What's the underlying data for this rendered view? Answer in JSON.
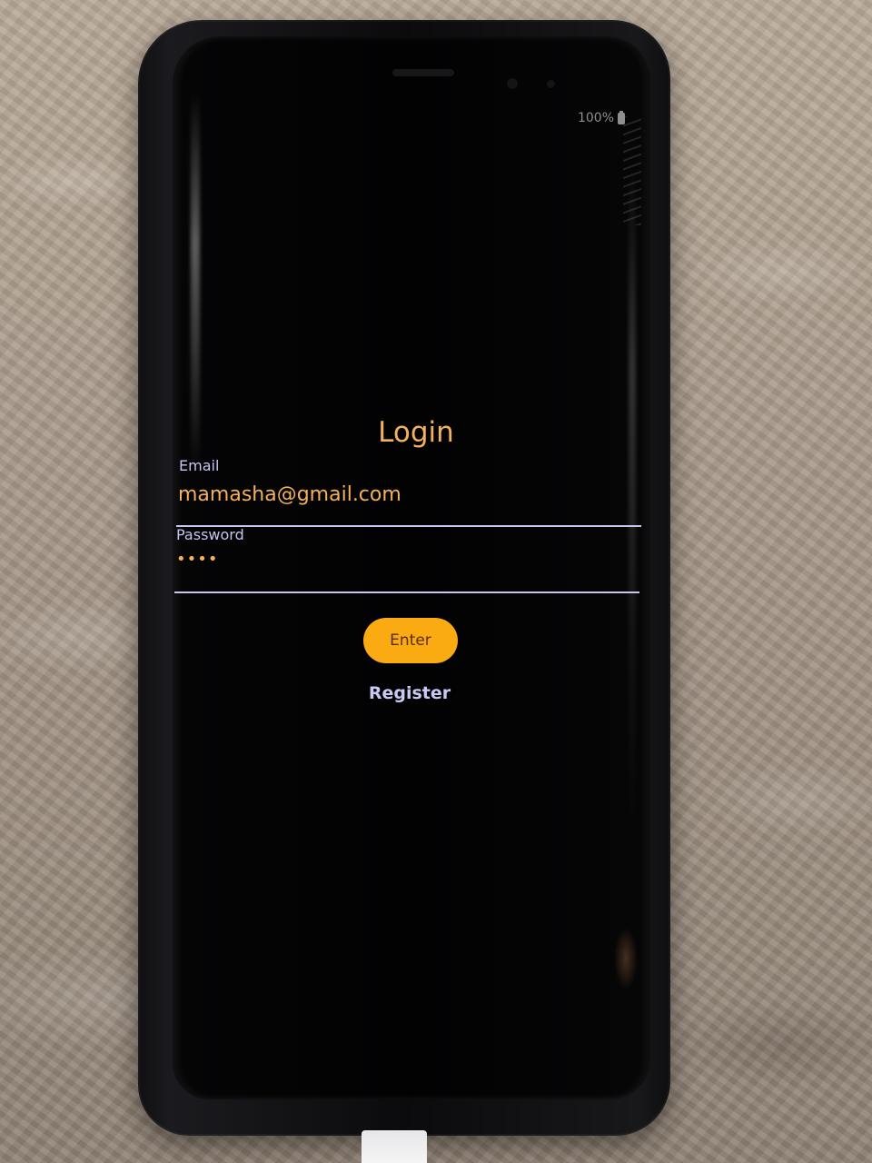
{
  "status_bar": {
    "battery_level": "100%",
    "battery_icon": "battery-icon"
  },
  "login": {
    "title": "Login",
    "email_label": "Email",
    "email_value": "mamasha@gmail.com",
    "password_label": "Password",
    "password_value": "••••",
    "enter_label": "Enter",
    "register_label": "Register"
  },
  "colors": {
    "accent": "#fbab12",
    "title_text": "#f4b15a",
    "label_text": "#c4c6f0",
    "screen_background": "#020203"
  }
}
